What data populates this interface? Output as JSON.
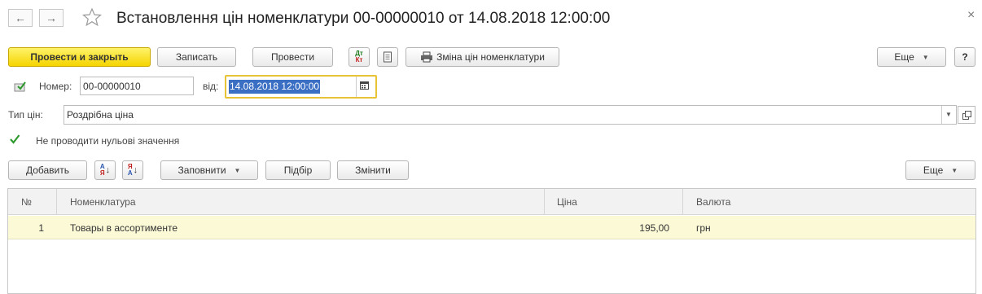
{
  "window": {
    "title": "Встановлення цін номенклатури 00-00000010 от 14.08.2018 12:00:00",
    "close_glyph": "×"
  },
  "toolbar": {
    "post_close": "Провести и закрыть",
    "save": "Записать",
    "post": "Провести",
    "dtkt_top": "Дт",
    "dtkt_bottom": "Кт",
    "print_report": "Зміна цін номенклатури",
    "more": "Еще",
    "help": "?"
  },
  "header": {
    "number_label": "Номер:",
    "number_value": "00-00000010",
    "date_label": "від:",
    "date_value": "14.08.2018 12:00:00",
    "price_type_label": "Тип цін:",
    "price_type_value": "Роздрібна ціна",
    "skip_zero_label": "Не проводити нульові значення",
    "skip_zero_checked": true
  },
  "table_toolbar": {
    "add": "Добавить",
    "sort_asc_top": "А",
    "sort_asc_bottom": "Я",
    "sort_desc_top": "Я",
    "sort_desc_bottom": "А",
    "fill": "Заповнити",
    "selection": "Підбір",
    "change": "Змінити",
    "more": "Еще"
  },
  "table": {
    "columns": [
      "№",
      "Номенклатура",
      "Ціна",
      "Валюта"
    ],
    "rows": [
      {
        "n": "1",
        "item": "Товары в ассортименте",
        "price": "195,00",
        "currency": "грн"
      }
    ]
  },
  "colors": {
    "accent_yellow": "#f5d400",
    "focus_border": "#e8c335",
    "selected_row": "#fbf9d6",
    "selection_text_bg": "#3a6fc4"
  }
}
